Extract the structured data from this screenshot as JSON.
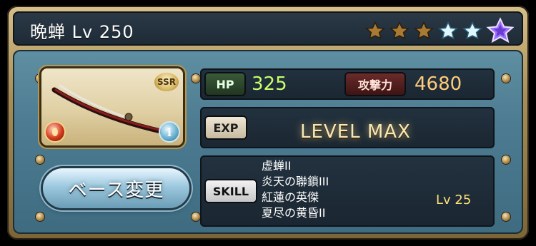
{
  "header": {
    "title": "晩蝉 Lv 250",
    "stars": [
      {
        "type": "gold",
        "filled": true
      },
      {
        "type": "gold",
        "filled": true
      },
      {
        "type": "gold",
        "filled": true
      },
      {
        "type": "blue",
        "filled": true
      },
      {
        "type": "blue",
        "filled": true
      },
      {
        "type": "purple",
        "filled": true
      }
    ]
  },
  "weapon_card": {
    "rarity_badge": "SSR",
    "element_icon": "fire-element-icon",
    "info_icon_label": "i",
    "info_icon": "info-icon"
  },
  "actions": {
    "base_change_button_label": "ベース変更"
  },
  "stats": {
    "hp_label": "HP",
    "hp_value": "325",
    "attack_label": "攻撃力",
    "attack_value": "4680"
  },
  "exp": {
    "label": "EXP",
    "status": "LEVEL MAX"
  },
  "skills": {
    "label": "SKILL",
    "items": [
      "虚蝉II",
      "炎天の聯鎖III",
      "紅蓮の英傑",
      "夏尽の黄昏II"
    ],
    "level_text": "Lv 25"
  },
  "colors": {
    "frame_gold": "#b6974f",
    "panel_blue": "#4d7c92",
    "header_dark": "#1d2a36",
    "hp_green": "#c7ff6a",
    "attack_orange": "#ffcc7a",
    "skill_level_yellow": "#ffe27a"
  }
}
